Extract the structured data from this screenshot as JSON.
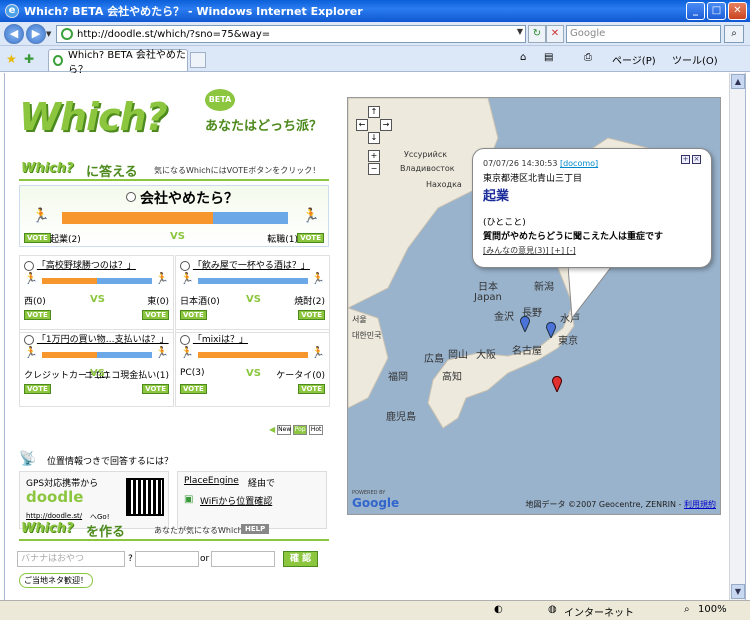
{
  "window": {
    "title": "Which? BETA 会社やめたら？ - Windows Internet Explorer",
    "minimize_label": "_",
    "maximize_label": "□",
    "close_label": "✕"
  },
  "address_bar": {
    "url": "http://doodle.st/which/?sno=75&way=",
    "search_placeholder": "Google"
  },
  "tab": {
    "label": "Which? BETA 会社やめたら？"
  },
  "commands": {
    "page": "ページ(P)",
    "tools": "ツール(O)"
  },
  "site": {
    "logo": "Which?",
    "beta": "BETA",
    "tagline": "あなたはどっち派？"
  },
  "answer_section": {
    "logo": "Which?",
    "heading": "に答える",
    "subtext": "気になるWhichにはVOTEボタンをクリック！"
  },
  "main_question": {
    "title": "会社やめたら？",
    "left_label": "起業(2)",
    "right_label": "転職(1)",
    "left_share": 0.667,
    "vs": "VS",
    "vote": "VOTE"
  },
  "questions": [
    {
      "title": "「高校野球勝つのは？」",
      "left": "西(0)",
      "right": "東(0)",
      "left_share": 0.5
    },
    {
      "title": "「飲み屋で一杯やる酒は？」",
      "left": "日本酒(0)",
      "right": "焼酎(2)",
      "left_share": 0.0
    },
    {
      "title": "「1万円の買い物…支払いは？」",
      "left": "クレジットカード(1)",
      "right": "ニコニコ現金払い(1)",
      "left_share": 0.5
    },
    {
      "title": "「mixiは？」",
      "left": "PC(3)",
      "right": "ケータイ(0)",
      "left_share": 1.0
    }
  ],
  "paging": [
    "New",
    "Pop",
    "Hot"
  ],
  "location_section": {
    "heading": "位置情報つきで回答するには？",
    "gps_text": "GPS対応携帯から",
    "gps_logo": "doodle",
    "gps_link": "http://doodle.st/",
    "gps_link_suffix": "へGo!",
    "place_engine": "PlaceEngine",
    "place_engine_suffix": "経由で",
    "wifi": "WiFiから位置確認"
  },
  "create_section": {
    "logo": "Which?",
    "heading": "を作る",
    "subtext": "あなたが気になるWhich作成！",
    "help": "HELP",
    "input1_placeholder": "バナナはおやつ",
    "q_mark": "?",
    "or_label": "or",
    "submit": "確 認",
    "note": "ご当地ネタ歓迎！"
  },
  "map": {
    "labels": {
      "ussuriysk": "Уссурийск",
      "vladivostok": "Владивосток",
      "nakhodka": "Находка",
      "japan_jp": "日本",
      "japan_en": "Japan",
      "niigata": "新潟",
      "nagano": "長野",
      "kanazawa": "金沢",
      "mito": "水戸",
      "tokyo": "東京",
      "nagoya": "名古屋",
      "osaka": "大阪",
      "okayama": "岡山",
      "hiroshima": "広島",
      "fukuoka": "福岡",
      "kochi": "高知",
      "kagoshima": "鹿児島",
      "seoul": "서울",
      "korea": "대한민국"
    },
    "bubble": {
      "timestamp": "07/07/26 14:30:53",
      "user": "[docomo]",
      "address": "東京都港区北青山三丁目",
      "answer": "起業",
      "hitokoto": "(ひとこと)",
      "comment": "質問がやめたらどうに聞こえた人は重症です",
      "links": "[みんなの意見(3)] [+] [-]"
    },
    "attribution": "地図データ ©2007 Geocentre, ZENRIN - ",
    "terms": "利用規約",
    "powered_by": "POWERED BY",
    "google": "Google"
  },
  "statusbar": {
    "zone": "インターネット",
    "zoom": "100%"
  },
  "colors": {
    "brand_green": "#8cc63f",
    "orange": "#f7962c",
    "blue": "#6aa8e8"
  }
}
